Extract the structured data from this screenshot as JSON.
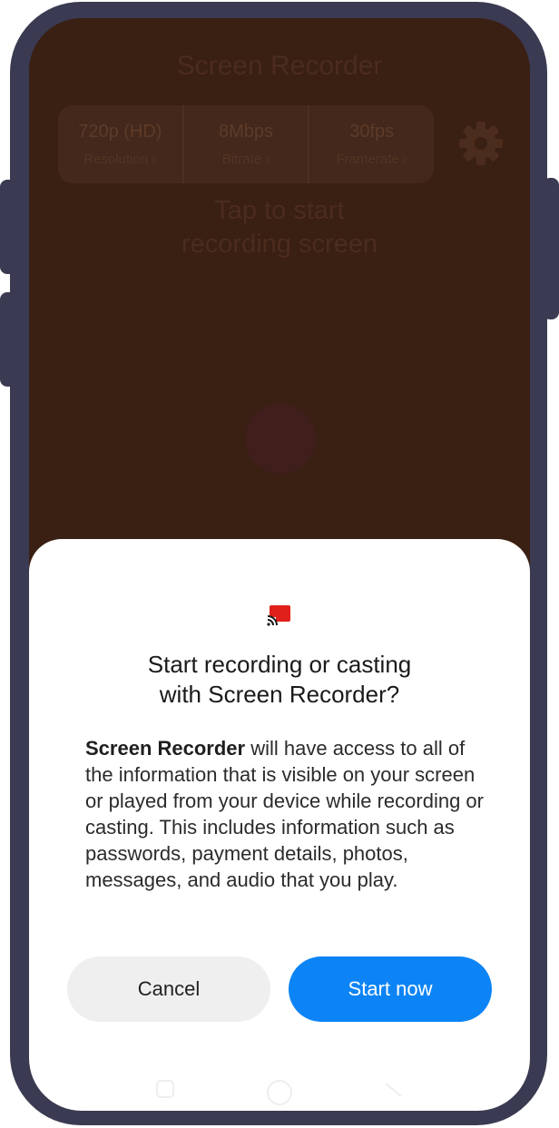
{
  "app": {
    "title": "Screen Recorder",
    "settings": [
      {
        "value": "720p (HD)",
        "label": "Resolution"
      },
      {
        "value": "8Mbps",
        "label": "Bitrate"
      },
      {
        "value": "30fps",
        "label": "Framerate"
      }
    ],
    "tap_line1": "Tap to start",
    "tap_line2": "recording screen"
  },
  "dialog": {
    "title_line1": "Start recording or casting",
    "title_line2": "with Screen Recorder?",
    "body_app_name": "Screen Recorder",
    "body_text": " will have access to all of the information that is visible on your screen or played from your device while recording or casting. This includes information such as passwords, payment details, photos, messages, and audio that you play.",
    "cancel_label": "Cancel",
    "start_label": "Start now"
  },
  "colors": {
    "accent": "#0d84f5",
    "cast_icon": "#e0201b",
    "frame": "#3a3a52",
    "dim_background": "#3a1f13"
  },
  "icons": [
    "cast-icon",
    "gear-icon",
    "chevron-right-icon",
    "nav-home-icon",
    "nav-back-icon",
    "nav-recents-icon"
  ]
}
